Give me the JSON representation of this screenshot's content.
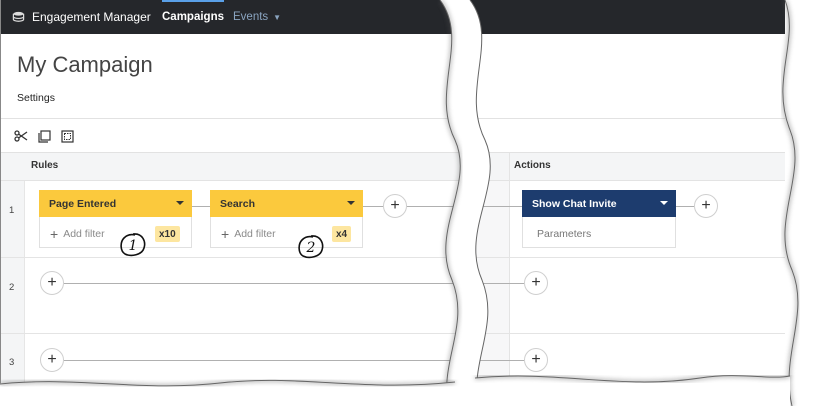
{
  "app": {
    "brand": "Engagement Manager"
  },
  "nav": {
    "campaigns": "Campaigns",
    "events": "Events"
  },
  "page": {
    "title": "My Campaign",
    "settings": "Settings"
  },
  "toolbar": {
    "icons": [
      "scissors-icon",
      "copy-icon",
      "select-area-icon"
    ]
  },
  "columns": {
    "rules": "Rules",
    "actions": "Actions"
  },
  "rows": [
    {
      "number": "1",
      "rules": [
        {
          "label": "Page Entered",
          "add_filter": "Add filter",
          "count": "x10",
          "callout": "1"
        },
        {
          "label": "Search",
          "add_filter": "Add filter",
          "count": "x4",
          "callout": "2"
        }
      ],
      "action": {
        "label": "Show Chat Invite",
        "params": "Parameters"
      }
    },
    {
      "number": "2"
    },
    {
      "number": "3"
    }
  ],
  "colors": {
    "topbar": "#25272b",
    "rule_header": "#fbc93d",
    "action_header": "#1d3c6e",
    "badge": "#fde6a0"
  }
}
